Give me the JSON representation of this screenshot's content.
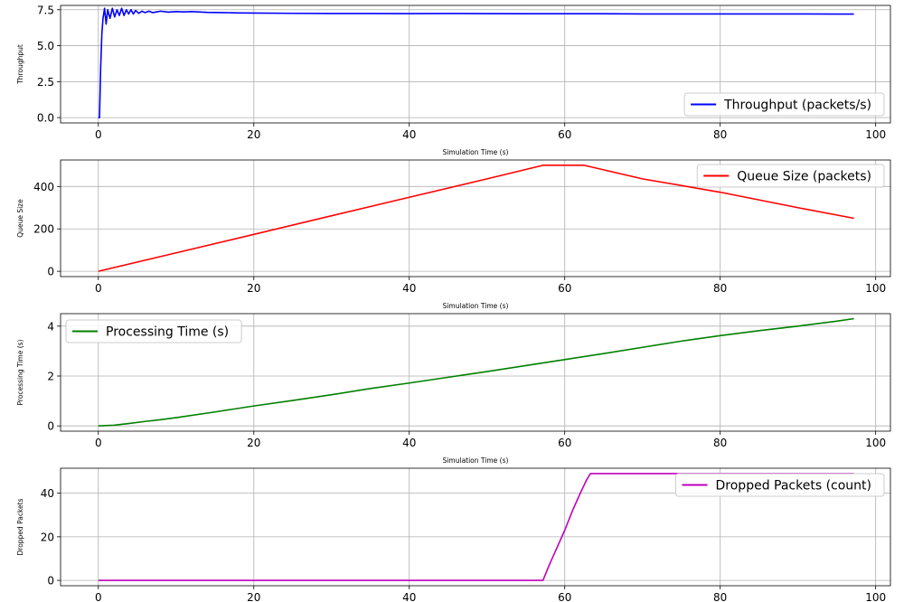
{
  "chart_data": [
    {
      "type": "line",
      "xlabel": "Simulation Time (s)",
      "ylabel": "Throughput",
      "xlim": [
        -4.86,
        101.9
      ],
      "ylim": [
        -0.37,
        7.8
      ],
      "xticks": [
        "0",
        "20",
        "40",
        "60",
        "80",
        "100"
      ],
      "yticks": [
        "0.0",
        "2.5",
        "5.0",
        "7.5"
      ],
      "legend": "lower right",
      "grid": true,
      "series": [
        {
          "name": "Throughput (packets/s)",
          "color": "#0000ff",
          "x": [
            0,
            0.15,
            0.3,
            0.45,
            0.6,
            0.8,
            1.0,
            1.2,
            1.5,
            1.8,
            2.1,
            2.4,
            2.7,
            3.0,
            3.3,
            3.6,
            3.9,
            4.2,
            4.5,
            4.8,
            5.2,
            5.6,
            6,
            6.5,
            7,
            7.5,
            8,
            9,
            10,
            11,
            12,
            14,
            16,
            18,
            20,
            25,
            30,
            35,
            40,
            45,
            50,
            55,
            60,
            65,
            70,
            75,
            80,
            85,
            90,
            95,
            97.2
          ],
          "y": [
            0.0,
            0.0,
            3.5,
            5.8,
            6.9,
            7.6,
            6.5,
            7.5,
            6.9,
            7.6,
            7.0,
            7.5,
            7.1,
            7.6,
            7.1,
            7.5,
            7.2,
            7.5,
            7.2,
            7.45,
            7.25,
            7.4,
            7.3,
            7.4,
            7.3,
            7.35,
            7.4,
            7.33,
            7.37,
            7.35,
            7.37,
            7.32,
            7.3,
            7.28,
            7.27,
            7.25,
            7.24,
            7.24,
            7.23,
            7.24,
            7.23,
            7.22,
            7.22,
            7.22,
            7.21,
            7.21,
            7.21,
            7.21,
            7.21,
            7.2,
            7.2
          ]
        }
      ]
    },
    {
      "type": "line",
      "xlabel": "Simulation Time (s)",
      "ylabel": "Queue Size",
      "xlim": [
        -4.86,
        101.9
      ],
      "ylim": [
        -25,
        525
      ],
      "xticks": [
        "0",
        "20",
        "40",
        "60",
        "80",
        "100"
      ],
      "yticks": [
        "0",
        "200",
        "400"
      ],
      "legend": "upper right",
      "grid": true,
      "series": [
        {
          "name": "Queue Size (packets)",
          "color": "#ff0000",
          "x": [
            0,
            10,
            20,
            30,
            40,
            50,
            57.2,
            62.5,
            70,
            80,
            90,
            97.2
          ],
          "y": [
            0,
            87,
            174,
            262,
            349,
            436,
            500,
            500,
            436,
            373,
            300,
            250
          ]
        }
      ]
    },
    {
      "type": "line",
      "xlabel": "Simulation Time (s)",
      "ylabel": "Processing Time (s)",
      "xlim": [
        -4.86,
        101.9
      ],
      "ylim": [
        -0.21,
        4.5
      ],
      "xticks": [
        "0",
        "20",
        "40",
        "60",
        "80",
        "100"
      ],
      "yticks": [
        "0",
        "2",
        "4"
      ],
      "legend": "upper left",
      "grid": true,
      "series": [
        {
          "name": "Processing Time (s)",
          "color": "#008000",
          "x": [
            0,
            2,
            4,
            6,
            8,
            10,
            15,
            20,
            25,
            30,
            35,
            40,
            45,
            50,
            55,
            60,
            65,
            70,
            75,
            80,
            85,
            90,
            95,
            97.2
          ],
          "y": [
            0,
            0.03,
            0.1,
            0.18,
            0.25,
            0.33,
            0.56,
            0.8,
            1.02,
            1.25,
            1.5,
            1.72,
            1.95,
            2.18,
            2.42,
            2.66,
            2.9,
            3.15,
            3.4,
            3.62,
            3.82,
            4.0,
            4.2,
            4.3
          ]
        }
      ]
    },
    {
      "type": "line",
      "xlabel": "",
      "ylabel": "Dropped Packets",
      "xlim": [
        -4.86,
        101.9
      ],
      "ylim": [
        -2.45,
        51.45
      ],
      "xticks": [
        "0",
        "20",
        "40",
        "60",
        "80",
        "100"
      ],
      "yticks": [
        "0",
        "20",
        "40"
      ],
      "legend": "upper right",
      "grid": true,
      "series": [
        {
          "name": "Dropped Packets (count)",
          "color": "#bf00bf",
          "x": [
            0,
            57.2,
            58,
            59,
            60,
            61,
            62,
            62.8,
            63.3,
            70,
            80,
            90,
            97.2
          ],
          "y": [
            0,
            0,
            7,
            15,
            23,
            32,
            40,
            46,
            49,
            49,
            49,
            49,
            49
          ]
        }
      ]
    }
  ]
}
